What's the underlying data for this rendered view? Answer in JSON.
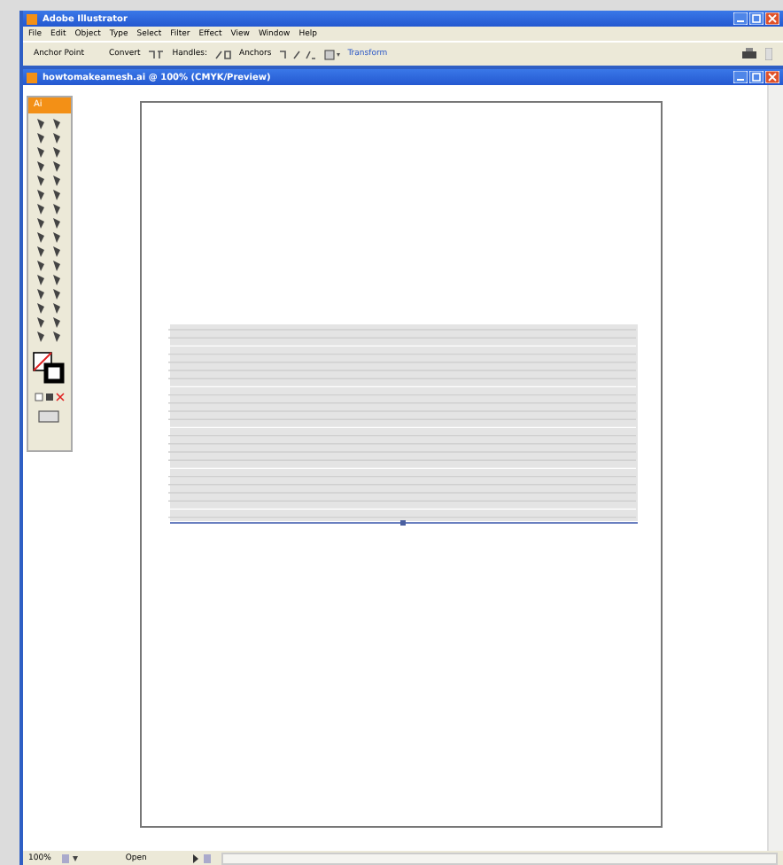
{
  "window": {
    "title": "Adobe Illustrator"
  },
  "menu": [
    "File",
    "Edit",
    "Object",
    "Type",
    "Select",
    "Filter",
    "Effect",
    "View",
    "Window",
    "Help"
  ],
  "control_bar": {
    "tool": "Anchor Point",
    "convert": "Convert",
    "handles": "Handles:",
    "anchors": "Anchors",
    "transform": "Transform"
  },
  "document": {
    "title": "howtomakeamesh.ai @ 100% (CMYK/Preview)"
  },
  "toolbox": {
    "logo": "Ai"
  },
  "status_bar": {
    "zoom": "100%",
    "status": "Open"
  }
}
